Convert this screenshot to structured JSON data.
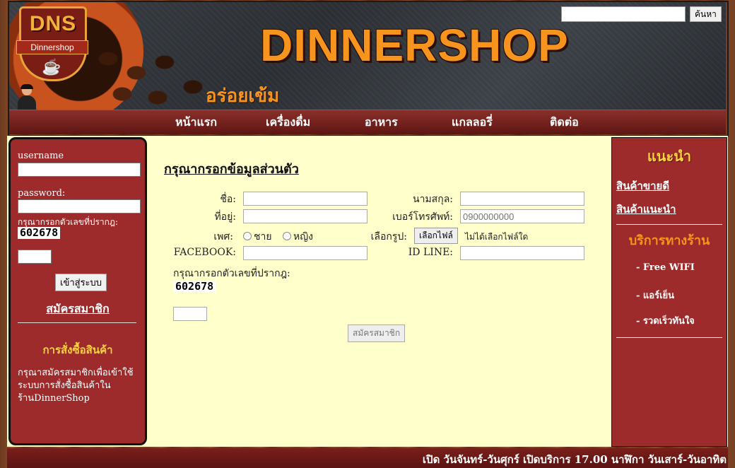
{
  "search": {
    "placeholder": "",
    "button": "ค้นหา"
  },
  "header": {
    "logo_text": "DNS",
    "logo_ribbon": "Dinnershop",
    "brand": "DINNERSHOP",
    "slogan": "อร่อยเข้ม"
  },
  "nav": {
    "items": [
      "หน้าแรก",
      "เครื่องดื่ม",
      "อาหาร",
      "แกลลอรี่",
      "ติดต่อ"
    ]
  },
  "login": {
    "username_label": "username",
    "password_label": "password:",
    "captcha_label": "กรุณากรอกตัวเลขที่ปรากฎ:",
    "captcha_code": "602678",
    "login_button": "เข้าสู่ระบบ",
    "register_link": "สมัครสมาชิก",
    "order_heading": "การสั่งซื้อสินค้า",
    "order_text": "กรุณาสมัครสมาชิกเพื่อเข้าใช้ระบบการสั่งซื้อสินค้าในร้านDinnerShop"
  },
  "form": {
    "title": "กรุณากรอกข้อมูลส่วนตัว",
    "name_label": "ชื่อ:",
    "surname_label": "นามสกุล:",
    "address_label": "ที่อยู่:",
    "phone_label": "เบอร์โทรศัพท์:",
    "phone_placeholder": "0900000000",
    "gender_label": "เพศ:",
    "gender_options": [
      "ชาย",
      "หญิง"
    ],
    "photo_label": "เลือกรูป:",
    "file_button": "เลือกไฟล์",
    "file_status": "ไม่ได้เลือกไฟล์ใด",
    "facebook_label": "FACEBOOK:",
    "line_label": "ID  LINE:",
    "captcha_label": "กรุณากรอกตัวเลขที่ปรากฎ:",
    "captcha_code": "602678",
    "submit_button": "สมัครสมาชิก"
  },
  "sidebar_right": {
    "heading": "แนะนำ",
    "links": [
      "สินค้าขายดี",
      "สินค้าแนะนำ"
    ],
    "service_heading": "บริการทางร้าน",
    "services": [
      "-  Free  WIFI",
      "-  แอร์เย็น",
      "-  รวดเร็วทันใจ"
    ]
  },
  "footer": {
    "hours": "เปิด  วันจันทร์-วันศุกร์  เปิดบริการ  17.00  นาฬิกา  วันเสาร์-วันอาทิต"
  }
}
